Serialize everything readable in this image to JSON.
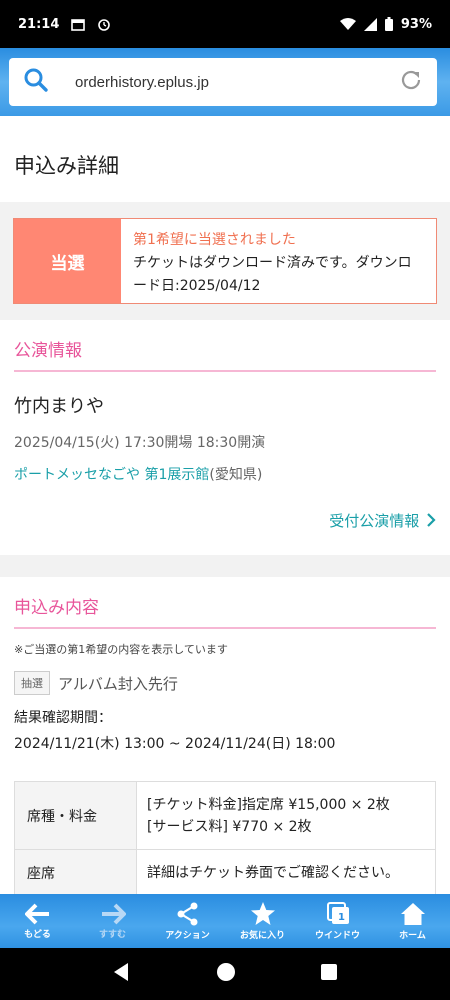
{
  "status_bar": {
    "time": "21:14",
    "battery": "93%"
  },
  "browser": {
    "url": "orderhistory.eplus.jp"
  },
  "page": {
    "title": "申込み詳細"
  },
  "result": {
    "label": "当選",
    "heading": "第1希望に当選されました",
    "message": "チケットはダウンロード済みです。ダウンロード日:2025/04/12"
  },
  "performance": {
    "section_title": "公演情報",
    "name": "竹内まりや",
    "datetime": "2025/04/15(火) 17:30開場 18:30開演",
    "venue": "ポートメッセなごや 第1展示館",
    "prefecture": "(愛知県)",
    "info_link": "受付公演情報"
  },
  "application": {
    "section_title": "申込み内容",
    "note": "※ご当選の第1希望の内容を表示しています",
    "lottery_tag": "抽選",
    "lottery_name": "アルバム封入先行",
    "period_label": "結果確認期間：",
    "period_value": "2024/11/21(木) 13:00 ~ 2024/11/24(日) 18:00",
    "table": {
      "seat_price_label": "席種・料金",
      "seat_price_line1": "[チケット料金]指定席 ¥15,000 × 2枚",
      "seat_price_line2": "[サービス料] ¥770 × 2枚",
      "seat_label": "座席",
      "seat_value": "詳細はチケット券面でご確認ください。"
    }
  },
  "toolbar": {
    "back": "もどる",
    "forward": "すすむ",
    "action": "アクション",
    "favorites": "お気に入り",
    "window": "ウインドウ",
    "window_count": "1",
    "home": "ホーム"
  },
  "colors": {
    "accent_blue": "#2a8de0",
    "win_red": "#ff8773",
    "section_pink": "#e8559a",
    "link_teal": "#1a9fa8"
  }
}
